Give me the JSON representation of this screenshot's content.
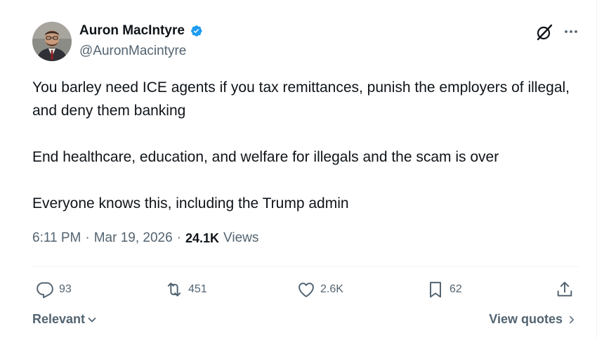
{
  "author": {
    "name": "Auron MacIntyre",
    "handle": "@AuronMacintyre",
    "verified": true,
    "badge_color": "#1d9bf0"
  },
  "post": {
    "paragraphs": [
      "You barley need ICE agents if you tax remittances, punish the employers of illegal, and deny them banking",
      "End healthcare, education, and welfare for illegals and the scam is over",
      "Everyone knows this, including the Trump admin"
    ],
    "time": "6:11 PM",
    "separator": "·",
    "date": "Mar 19, 2026",
    "views_count": "24.1K",
    "views_label": "Views"
  },
  "actions": {
    "replies": {
      "count": "93",
      "icon": "reply-icon"
    },
    "reposts": {
      "count": "451",
      "icon": "repost-icon"
    },
    "likes": {
      "count": "2.6K",
      "icon": "like-icon"
    },
    "bookmarks": {
      "count": "62",
      "icon": "bookmark-icon"
    },
    "share": {
      "icon": "share-icon"
    }
  },
  "footer": {
    "sort_label": "Relevant",
    "view_quotes_label": "View quotes"
  },
  "colors": {
    "text": "#0f1419",
    "secondary": "#536471",
    "accent": "#1d9bf0",
    "border": "#eff3f4"
  }
}
